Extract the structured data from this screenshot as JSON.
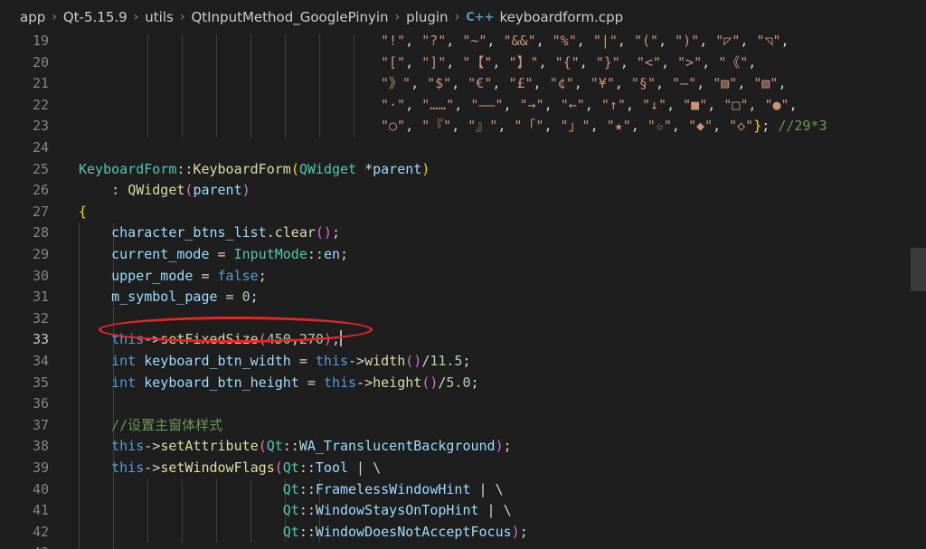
{
  "breadcrumb": {
    "items": [
      "app",
      "Qt-5.15.9",
      "utils",
      "QtInputMethod_GooglePinyin",
      "plugin"
    ],
    "file_icon": "C++",
    "file": "keyboardform.cpp"
  },
  "editor": {
    "active_line": "33",
    "lines": [
      {
        "n": "19",
        "tokens": [
          [
            "str",
            "\"!\""
          ],
          [
            "op",
            ", "
          ],
          [
            "str",
            "\"?\""
          ],
          [
            "op",
            ", "
          ],
          [
            "str",
            "\"~\""
          ],
          [
            "op",
            ", "
          ],
          [
            "str",
            "\"&&\""
          ],
          [
            "op",
            ", "
          ],
          [
            "str",
            "\"%\""
          ],
          [
            "op",
            ", "
          ],
          [
            "str",
            "\"|\""
          ],
          [
            "op",
            ", "
          ],
          [
            "str",
            "\"(\""
          ],
          [
            "op",
            ", "
          ],
          [
            "str",
            "\")\""
          ],
          [
            "op",
            ", "
          ],
          [
            "str",
            "\"◸\""
          ],
          [
            "op",
            ", "
          ],
          [
            "str",
            "\"◹\""
          ],
          [
            "op",
            ","
          ]
        ]
      },
      {
        "n": "20",
        "tokens": [
          [
            "str",
            "\"[\""
          ],
          [
            "op",
            ", "
          ],
          [
            "str",
            "\"]\""
          ],
          [
            "op",
            ", "
          ],
          [
            "str",
            "\"【\""
          ],
          [
            "op",
            ", "
          ],
          [
            "str",
            "\"】\""
          ],
          [
            "op",
            ", "
          ],
          [
            "str",
            "\"{\""
          ],
          [
            "op",
            ", "
          ],
          [
            "str",
            "\"}\""
          ],
          [
            "op",
            ", "
          ],
          [
            "str",
            "\"<\""
          ],
          [
            "op",
            ", "
          ],
          [
            "str",
            "\">\""
          ],
          [
            "op",
            ", "
          ],
          [
            "str",
            "\"《\""
          ],
          [
            "op",
            ","
          ]
        ]
      },
      {
        "n": "21",
        "tokens": [
          [
            "str",
            "\"》\""
          ],
          [
            "op",
            ", "
          ],
          [
            "str",
            "\"$\""
          ],
          [
            "op",
            ", "
          ],
          [
            "str",
            "\"€\""
          ],
          [
            "op",
            ", "
          ],
          [
            "str",
            "\"£\""
          ],
          [
            "op",
            ", "
          ],
          [
            "str",
            "\"¢\""
          ],
          [
            "op",
            ", "
          ],
          [
            "str",
            "\"¥\""
          ],
          [
            "op",
            ", "
          ],
          [
            "str",
            "\"§\""
          ],
          [
            "op",
            ", "
          ],
          [
            "str",
            "\"—\""
          ],
          [
            "op",
            ", "
          ],
          [
            "str",
            "\"▨\""
          ],
          [
            "op",
            ", "
          ],
          [
            "str",
            "\"▧\""
          ],
          [
            "op",
            ","
          ]
        ]
      },
      {
        "n": "22",
        "tokens": [
          [
            "str",
            "\"·\""
          ],
          [
            "op",
            ", "
          ],
          [
            "str",
            "\"……\""
          ],
          [
            "op",
            ", "
          ],
          [
            "str",
            "\"——\""
          ],
          [
            "op",
            ", "
          ],
          [
            "str",
            "\"→\""
          ],
          [
            "op",
            ", "
          ],
          [
            "str",
            "\"←\""
          ],
          [
            "op",
            ", "
          ],
          [
            "str",
            "\"↑\""
          ],
          [
            "op",
            ", "
          ],
          [
            "str",
            "\"↓\""
          ],
          [
            "op",
            ", "
          ],
          [
            "str",
            "\"■\""
          ],
          [
            "op",
            ", "
          ],
          [
            "str",
            "\"□\""
          ],
          [
            "op",
            ", "
          ],
          [
            "str",
            "\"●\""
          ],
          [
            "op",
            ","
          ]
        ]
      },
      {
        "n": "23",
        "tokens": [
          [
            "str",
            "\"○\""
          ],
          [
            "op",
            ", "
          ],
          [
            "str",
            "\"『\""
          ],
          [
            "op",
            ", "
          ],
          [
            "str",
            "\"』\""
          ],
          [
            "op",
            ", "
          ],
          [
            "str",
            "\"「\""
          ],
          [
            "op",
            ", "
          ],
          [
            "str",
            "\"」\""
          ],
          [
            "op",
            ", "
          ],
          [
            "str",
            "\"★\""
          ],
          [
            "op",
            ", "
          ],
          [
            "str",
            "\"☆\""
          ],
          [
            "op",
            ", "
          ],
          [
            "str",
            "\"◆\""
          ],
          [
            "op",
            ", "
          ],
          [
            "str",
            "\"◇\""
          ],
          [
            "py",
            "}"
          ],
          [
            "op",
            "; "
          ],
          [
            "cm",
            "//29*3"
          ]
        ]
      },
      {
        "n": "24",
        "tokens": []
      },
      {
        "n": "25",
        "tokens": [
          [
            "ty",
            "KeyboardForm"
          ],
          [
            "op",
            "::"
          ],
          [
            "fn",
            "KeyboardForm"
          ],
          [
            "py",
            "("
          ],
          [
            "ty",
            "QWidget"
          ],
          [
            "op",
            " *"
          ],
          [
            "var",
            "parent"
          ],
          [
            "py",
            ")"
          ]
        ]
      },
      {
        "n": "26",
        "tokens": [
          [
            "op",
            "    : "
          ],
          [
            "fn",
            "QWidget"
          ],
          [
            "pn",
            "("
          ],
          [
            "var",
            "parent"
          ],
          [
            "pn",
            ")"
          ]
        ]
      },
      {
        "n": "27",
        "tokens": [
          [
            "py",
            "{"
          ]
        ]
      },
      {
        "n": "28",
        "tokens": [
          [
            "op",
            "    "
          ],
          [
            "var",
            "character_btns_list"
          ],
          [
            "op",
            "."
          ],
          [
            "fn",
            "clear"
          ],
          [
            "pn",
            "()"
          ],
          [
            "op",
            ";"
          ]
        ]
      },
      {
        "n": "29",
        "tokens": [
          [
            "op",
            "    "
          ],
          [
            "var",
            "current_mode"
          ],
          [
            "op",
            " = "
          ],
          [
            "ty",
            "InputMode"
          ],
          [
            "op",
            "::"
          ],
          [
            "var",
            "en"
          ],
          [
            "op",
            ";"
          ]
        ]
      },
      {
        "n": "30",
        "tokens": [
          [
            "op",
            "    "
          ],
          [
            "var",
            "upper_mode"
          ],
          [
            "op",
            " = "
          ],
          [
            "kw",
            "false"
          ],
          [
            "op",
            ";"
          ]
        ]
      },
      {
        "n": "31",
        "tokens": [
          [
            "op",
            "    "
          ],
          [
            "var",
            "m_symbol_page"
          ],
          [
            "op",
            " = "
          ],
          [
            "num",
            "0"
          ],
          [
            "op",
            ";"
          ]
        ]
      },
      {
        "n": "32",
        "tokens": []
      },
      {
        "n": "33",
        "tokens": [
          [
            "op",
            "    "
          ],
          [
            "kw",
            "this"
          ],
          [
            "op",
            "->"
          ],
          [
            "fn",
            "setFixedSize"
          ],
          [
            "pn",
            "("
          ],
          [
            "num",
            "450"
          ],
          [
            "op",
            ","
          ],
          [
            "num",
            "270"
          ],
          [
            "pn",
            ")"
          ],
          [
            "op",
            ";"
          ]
        ],
        "cursor": true
      },
      {
        "n": "34",
        "tokens": [
          [
            "op",
            "    "
          ],
          [
            "kw",
            "int"
          ],
          [
            "op",
            " "
          ],
          [
            "var",
            "keyboard_btn_width"
          ],
          [
            "op",
            " = "
          ],
          [
            "kw",
            "this"
          ],
          [
            "op",
            "->"
          ],
          [
            "fn",
            "width"
          ],
          [
            "pn",
            "()"
          ],
          [
            "op",
            "/"
          ],
          [
            "num",
            "11.5"
          ],
          [
            "op",
            ";"
          ]
        ]
      },
      {
        "n": "35",
        "tokens": [
          [
            "op",
            "    "
          ],
          [
            "kw",
            "int"
          ],
          [
            "op",
            " "
          ],
          [
            "var",
            "keyboard_btn_height"
          ],
          [
            "op",
            " = "
          ],
          [
            "kw",
            "this"
          ],
          [
            "op",
            "->"
          ],
          [
            "fn",
            "height"
          ],
          [
            "pn",
            "()"
          ],
          [
            "op",
            "/"
          ],
          [
            "num",
            "5.0"
          ],
          [
            "op",
            ";"
          ]
        ]
      },
      {
        "n": "36",
        "tokens": []
      },
      {
        "n": "37",
        "tokens": [
          [
            "op",
            "    "
          ],
          [
            "cm",
            "//设置主窗体样式"
          ]
        ]
      },
      {
        "n": "38",
        "tokens": [
          [
            "op",
            "    "
          ],
          [
            "kw",
            "this"
          ],
          [
            "op",
            "->"
          ],
          [
            "fn",
            "setAttribute"
          ],
          [
            "pn",
            "("
          ],
          [
            "ns",
            "Qt"
          ],
          [
            "op",
            "::"
          ],
          [
            "var",
            "WA_TranslucentBackground"
          ],
          [
            "pn",
            ")"
          ],
          [
            "op",
            ";"
          ]
        ]
      },
      {
        "n": "39",
        "tokens": [
          [
            "op",
            "    "
          ],
          [
            "kw",
            "this"
          ],
          [
            "op",
            "->"
          ],
          [
            "fn",
            "setWindowFlags"
          ],
          [
            "pn",
            "("
          ],
          [
            "ns",
            "Qt"
          ],
          [
            "op",
            "::"
          ],
          [
            "var",
            "Tool"
          ],
          [
            "op",
            " | \\"
          ]
        ]
      },
      {
        "n": "40",
        "tokens": [
          [
            "op",
            "                         "
          ],
          [
            "ns",
            "Qt"
          ],
          [
            "op",
            "::"
          ],
          [
            "var",
            "FramelessWindowHint"
          ],
          [
            "op",
            " | \\"
          ]
        ]
      },
      {
        "n": "41",
        "tokens": [
          [
            "op",
            "                         "
          ],
          [
            "ns",
            "Qt"
          ],
          [
            "op",
            "::"
          ],
          [
            "var",
            "WindowStaysOnTopHint"
          ],
          [
            "op",
            " | \\"
          ]
        ]
      },
      {
        "n": "42",
        "tokens": [
          [
            "op",
            "                         "
          ],
          [
            "ns",
            "Qt"
          ],
          [
            "op",
            "::"
          ],
          [
            "var",
            "WindowDoesNotAcceptFocus"
          ],
          [
            "pn",
            ")"
          ],
          [
            "op",
            ";"
          ]
        ]
      },
      {
        "n": "43",
        "tokens": []
      }
    ]
  },
  "colors": {
    "background": "#1e1e1e",
    "annotation": "#e8242b"
  }
}
